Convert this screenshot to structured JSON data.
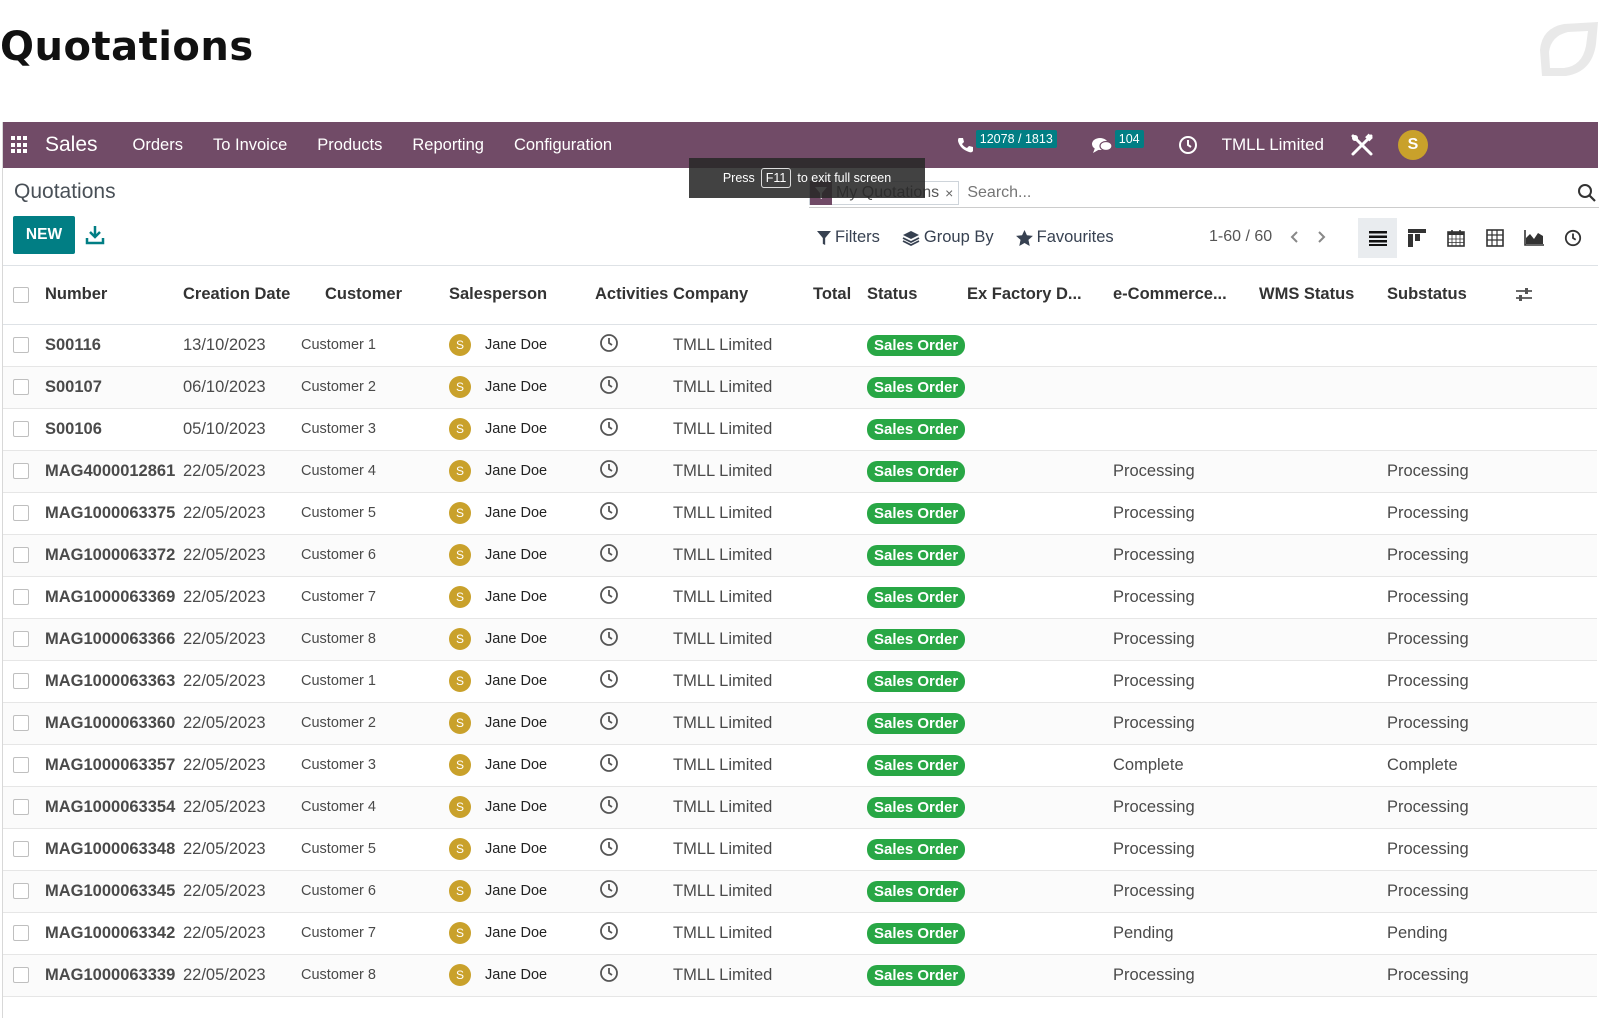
{
  "page_title": "Quotations",
  "navbar": {
    "brand": "Sales",
    "menu": [
      "Orders",
      "To Invoice",
      "Products",
      "Reporting",
      "Configuration"
    ],
    "phone_badge": "12078 / 1813",
    "chat_badge": "104",
    "company": "TMLL Limited",
    "avatar_letter": "S"
  },
  "control_panel": {
    "breadcrumb": "Quotations",
    "new_label": "NEW",
    "toast": {
      "press": "Press",
      "key": "F11",
      "rest": "to exit full screen"
    },
    "search": {
      "facet": "My Quotations",
      "facet_close": "×",
      "placeholder": "Search..."
    },
    "filters_label": "Filters",
    "groupby_label": "Group By",
    "favourites_label": "Favourites",
    "pager": "1-60 / 60"
  },
  "table": {
    "columns": [
      "Number",
      "Creation Date",
      "Customer",
      "Salesperson",
      "Activities",
      "Company",
      "Total",
      "Status",
      "Ex Factory D...",
      "e-Commerce...",
      "WMS Status",
      "Substatus"
    ],
    "rows": [
      {
        "number": "S00116",
        "date": "13/10/2023",
        "customer": "Customer 1",
        "sp_initial": "S",
        "salesperson": "Jane Doe",
        "company": "TMLL Limited",
        "total": "",
        "status": "Sales Order",
        "ex_factory": "",
        "ecommerce": "",
        "wms": "",
        "substatus": ""
      },
      {
        "number": "S00107",
        "date": "06/10/2023",
        "customer": "Customer 2",
        "sp_initial": "S",
        "salesperson": "Jane Doe",
        "company": "TMLL Limited",
        "total": "",
        "status": "Sales Order",
        "ex_factory": "",
        "ecommerce": "",
        "wms": "",
        "substatus": ""
      },
      {
        "number": "S00106",
        "date": "05/10/2023",
        "customer": "Customer 3",
        "sp_initial": "S",
        "salesperson": "Jane Doe",
        "company": "TMLL Limited",
        "total": "",
        "status": "Sales Order",
        "ex_factory": "",
        "ecommerce": "",
        "wms": "",
        "substatus": ""
      },
      {
        "number": "MAG4000012861",
        "date": "22/05/2023",
        "customer": "Customer 4",
        "sp_initial": "S",
        "salesperson": "Jane Doe",
        "company": "TMLL Limited",
        "total": "",
        "status": "Sales Order",
        "ex_factory": "",
        "ecommerce": "Processing",
        "wms": "",
        "substatus": "Processing"
      },
      {
        "number": "MAG1000063375",
        "date": "22/05/2023",
        "customer": "Customer 5",
        "sp_initial": "S",
        "salesperson": "Jane Doe",
        "company": "TMLL Limited",
        "total": "",
        "status": "Sales Order",
        "ex_factory": "",
        "ecommerce": "Processing",
        "wms": "",
        "substatus": "Processing"
      },
      {
        "number": "MAG1000063372",
        "date": "22/05/2023",
        "customer": "Customer 6",
        "sp_initial": "S",
        "salesperson": "Jane Doe",
        "company": "TMLL Limited",
        "total": "",
        "status": "Sales Order",
        "ex_factory": "",
        "ecommerce": "Processing",
        "wms": "",
        "substatus": "Processing"
      },
      {
        "number": "MAG1000063369",
        "date": "22/05/2023",
        "customer": "Customer 7",
        "sp_initial": "S",
        "salesperson": "Jane Doe",
        "company": "TMLL Limited",
        "total": "",
        "status": "Sales Order",
        "ex_factory": "",
        "ecommerce": "Processing",
        "wms": "",
        "substatus": "Processing"
      },
      {
        "number": "MAG1000063366",
        "date": "22/05/2023",
        "customer": "Customer 8",
        "sp_initial": "S",
        "salesperson": "Jane Doe",
        "company": "TMLL Limited",
        "total": "",
        "status": "Sales Order",
        "ex_factory": "",
        "ecommerce": "Processing",
        "wms": "",
        "substatus": "Processing"
      },
      {
        "number": "MAG1000063363",
        "date": "22/05/2023",
        "customer": "Customer 1",
        "sp_initial": "S",
        "salesperson": "Jane Doe",
        "company": "TMLL Limited",
        "total": "",
        "status": "Sales Order",
        "ex_factory": "",
        "ecommerce": "Processing",
        "wms": "",
        "substatus": "Processing"
      },
      {
        "number": "MAG1000063360",
        "date": "22/05/2023",
        "customer": "Customer 2",
        "sp_initial": "S",
        "salesperson": "Jane Doe",
        "company": "TMLL Limited",
        "total": "",
        "status": "Sales Order",
        "ex_factory": "",
        "ecommerce": "Processing",
        "wms": "",
        "substatus": "Processing"
      },
      {
        "number": "MAG1000063357",
        "date": "22/05/2023",
        "customer": "Customer 3",
        "sp_initial": "S",
        "salesperson": "Jane Doe",
        "company": "TMLL Limited",
        "total": "",
        "status": "Sales Order",
        "ex_factory": "",
        "ecommerce": "Complete",
        "wms": "",
        "substatus": "Complete"
      },
      {
        "number": "MAG1000063354",
        "date": "22/05/2023",
        "customer": "Customer 4",
        "sp_initial": "S",
        "salesperson": "Jane Doe",
        "company": "TMLL Limited",
        "total": "",
        "status": "Sales Order",
        "ex_factory": "",
        "ecommerce": "Processing",
        "wms": "",
        "substatus": "Processing"
      },
      {
        "number": "MAG1000063348",
        "date": "22/05/2023",
        "customer": "Customer 5",
        "sp_initial": "S",
        "salesperson": "Jane Doe",
        "company": "TMLL Limited",
        "total": "",
        "status": "Sales Order",
        "ex_factory": "",
        "ecommerce": "Processing",
        "wms": "",
        "substatus": "Processing"
      },
      {
        "number": "MAG1000063345",
        "date": "22/05/2023",
        "customer": "Customer 6",
        "sp_initial": "S",
        "salesperson": "Jane Doe",
        "company": "TMLL Limited",
        "total": "",
        "status": "Sales Order",
        "ex_factory": "",
        "ecommerce": "Processing",
        "wms": "",
        "substatus": "Processing"
      },
      {
        "number": "MAG1000063342",
        "date": "22/05/2023",
        "customer": "Customer 7",
        "sp_initial": "S",
        "salesperson": "Jane Doe",
        "company": "TMLL Limited",
        "total": "",
        "status": "Sales Order",
        "ex_factory": "",
        "ecommerce": "Pending",
        "wms": "",
        "substatus": "Pending"
      },
      {
        "number": "MAG1000063339",
        "date": "22/05/2023",
        "customer": "Customer 8",
        "sp_initial": "S",
        "salesperson": "Jane Doe",
        "company": "TMLL Limited",
        "total": "",
        "status": "Sales Order",
        "ex_factory": "",
        "ecommerce": "Processing",
        "wms": "",
        "substatus": "Processing"
      }
    ]
  },
  "colors": {
    "navbar": "#714b67",
    "primary": "#017e84",
    "status_green": "#28a745",
    "avatar": "#c9a12b"
  },
  "icons": [
    "apps-grid-icon",
    "phone-icon",
    "chat-icon",
    "clock-icon",
    "tools-icon",
    "download-icon",
    "filter-icon",
    "layers-icon",
    "star-icon",
    "search-icon",
    "chevron-left-icon",
    "chevron-right-icon",
    "list-view-icon",
    "kanban-view-icon",
    "calendar-view-icon",
    "pivot-view-icon",
    "graph-view-icon",
    "activity-view-icon",
    "optional-columns-icon"
  ]
}
